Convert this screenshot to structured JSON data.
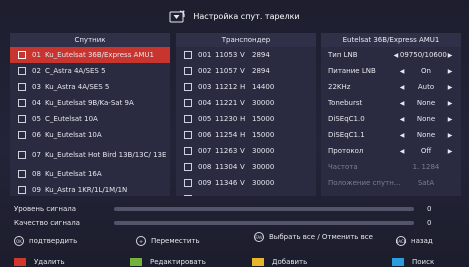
{
  "colors": {
    "red": "#d2352b",
    "green": "#74b43a",
    "yellow": "#e9b52a",
    "blue": "#2c9be0",
    "selected_row": "#c8342e"
  },
  "header": {
    "title": "Настройка спут. тарелки",
    "icon": "satellite-dish-icon"
  },
  "satellites": {
    "title": "Спутник",
    "items": [
      {
        "num": "01",
        "name": "Ku_Eutelsat 36B/Express AMU1"
      },
      {
        "num": "02",
        "name": "C_Astra 4A/SES 5"
      },
      {
        "num": "03",
        "name": "Ku_Astra 4A/SES 5"
      },
      {
        "num": "04",
        "name": "Ku_Eutelsat 9B/Ka-Sat 9A"
      },
      {
        "num": "05",
        "name": "C_Eutelsat 10A"
      },
      {
        "num": "06",
        "name": "Ku_Eutelsat 10A"
      },
      {
        "num": "07",
        "name": "Ku_Eutelsat Hot Bird 13B/13C/ 13E"
      },
      {
        "num": "08",
        "name": "Ku_Eutelsat 16A"
      },
      {
        "num": "09",
        "name": "Ku_Astra 1KR/1L/1M/1N"
      }
    ]
  },
  "transponders": {
    "title": "Транспондер",
    "items": [
      {
        "num": "001",
        "freq": "11053",
        "pol": "V",
        "sr": "2894"
      },
      {
        "num": "002",
        "freq": "11057",
        "pol": "V",
        "sr": "2894"
      },
      {
        "num": "003",
        "freq": "11212",
        "pol": "H",
        "sr": "14400"
      },
      {
        "num": "004",
        "freq": "11221",
        "pol": "V",
        "sr": "30000"
      },
      {
        "num": "005",
        "freq": "11230",
        "pol": "H",
        "sr": "15000"
      },
      {
        "num": "006",
        "freq": "11254",
        "pol": "H",
        "sr": "15000"
      },
      {
        "num": "007",
        "freq": "11263",
        "pol": "V",
        "sr": "30000"
      },
      {
        "num": "008",
        "freq": "11304",
        "pol": "V",
        "sr": "30000"
      },
      {
        "num": "009",
        "freq": "11346",
        "pol": "V",
        "sr": "30000"
      },
      {
        "num": "010",
        "freq": "11387",
        "pol": "V",
        "sr": "30000"
      }
    ]
  },
  "settings": {
    "title": "Eutelsat 36B/Express AMU1",
    "items": [
      {
        "label": "Тип LNB",
        "value": "09750/10600",
        "enabled": true
      },
      {
        "label": "Питание LNB",
        "value": "On",
        "enabled": true
      },
      {
        "label": "22KHz",
        "value": "Auto",
        "enabled": true
      },
      {
        "label": "Toneburst",
        "value": "None",
        "enabled": true
      },
      {
        "label": "DiSEqC1.0",
        "value": "None",
        "enabled": true
      },
      {
        "label": "DiSEqC1.1",
        "value": "None",
        "enabled": true
      },
      {
        "label": "Протокол",
        "value": "Off",
        "enabled": true
      },
      {
        "label": "Частота",
        "value": "1. 1284",
        "enabled": false
      },
      {
        "label": "Положение спутн...",
        "value": "SatA",
        "enabled": false
      }
    ]
  },
  "signal": {
    "level_label": "Уровень сигнала",
    "level_value": "0",
    "level_percent": 0,
    "quality_label": "Качество сигнала",
    "quality_value": "0",
    "quality_percent": 0
  },
  "help": {
    "ok_key": "OK",
    "ok_label": "подтвердить",
    "move_label": "Переместить",
    "fav_key": "FAV",
    "fav_label": "Выбрать все / Отменить все",
    "back_key": "BACK",
    "back_label": "назад"
  },
  "color_buttons": {
    "red": "Удалить",
    "green": "Редактировать",
    "yellow": "Добавить",
    "blue": "Поиск"
  }
}
